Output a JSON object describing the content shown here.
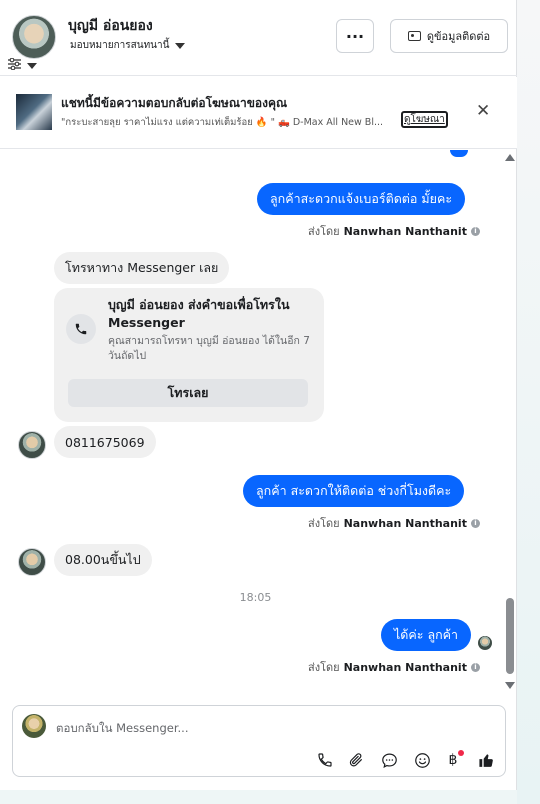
{
  "header": {
    "user_name": "บุญมี อ่อนยอง",
    "assign_label": "มอบหมายการสนทนานี้",
    "more_label": "···",
    "contact_info_label": "ดูข้อมูลติดต่อ"
  },
  "ad": {
    "title": "แชทนี้มีข้อความตอบกลับต่อโฆษณาของคุณ",
    "subtitle": "\"กระบะสายลุย ราคาไม่แรง แต่ความเท่เต็มร้อย 🔥 \" 🛻 D-Max All New Bl...",
    "link_label": "ดูโฆษณา",
    "close_label": "✕"
  },
  "messages": {
    "out_1": "ลูกค้าสะดวกแจ้งเบอร์ติดต่อ มั้ยคะ",
    "sent_by_prefix": "ส่งโดย",
    "sender_name": "Nanwhan Nanthanit",
    "in_1": "โทรหาทาง Messenger เลย",
    "call_title": "บุญมี อ่อนยอง ส่งคำขอเพื่อโทรใน Messenger",
    "call_desc": "คุณสามารถโทรหา บุญมี อ่อนยอง ได้ในอีก 7 วันถัดไป",
    "call_button": "โทรเลย",
    "in_2": "0811675069",
    "out_2": "ลูกค้า สะดวกให้ติดต่อ ช่วงกี่โมงดีคะ",
    "in_3": "08.00นขึ้นไป",
    "timestamp": "18:05",
    "out_3": "ได้ค่ะ  ลูกค้า"
  },
  "composer": {
    "placeholder": "ตอบกลับใน Messenger..."
  },
  "icons": {
    "filter": "sliders-icon",
    "phone": "phone-icon",
    "attach": "paperclip-icon",
    "saved_replies": "chat-bubble-icon",
    "emoji": "smiley-icon",
    "payment": "baht-icon",
    "like": "thumbs-up-icon"
  },
  "colors": {
    "accent": "#0866ff",
    "incoming_bubble": "#f0f0f0",
    "notification": "#f02849"
  }
}
